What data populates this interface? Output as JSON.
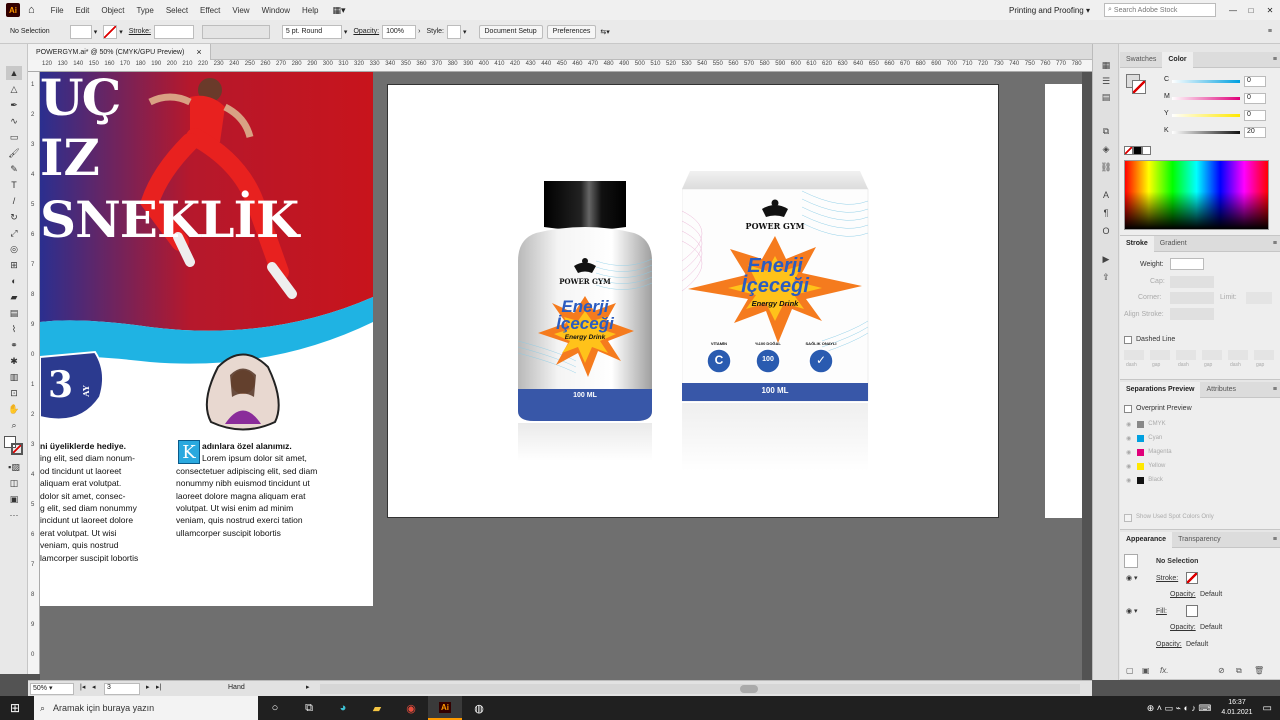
{
  "menubar": {
    "app_logo": "Ai",
    "items": [
      "File",
      "Edit",
      "Object",
      "Type",
      "Select",
      "Effect",
      "View",
      "Window",
      "Help"
    ],
    "workspace": "Printing and Proofing",
    "search_placeholder": "Search Adobe Stock"
  },
  "controlbar": {
    "selection": "No Selection",
    "stroke_label": "Stroke:",
    "brush": "5 pt. Round",
    "opacity_label": "Opacity:",
    "opacity_value": "100%",
    "style_label": "Style:",
    "document_setup": "Document Setup",
    "preferences": "Preferences"
  },
  "document": {
    "tab_title": "POWERGYM.ai* @ 50% (CMYK/GPU Preview)",
    "tab_close": "×"
  },
  "ruler": {
    "top": [
      "120",
      "130",
      "140",
      "150",
      "160",
      "170",
      "180",
      "190",
      "200",
      "210",
      "220",
      "230",
      "240",
      "250",
      "260",
      "270",
      "280",
      "290",
      "300",
      "310",
      "320",
      "330",
      "340",
      "350",
      "360",
      "370",
      "380",
      "390",
      "400",
      "410",
      "420",
      "430",
      "440",
      "450",
      "460",
      "470",
      "480",
      "490",
      "500",
      "510",
      "520",
      "530",
      "540",
      "550",
      "560",
      "570",
      "580",
      "590",
      "600",
      "610",
      "620",
      "630",
      "640",
      "650",
      "660",
      "670",
      "680",
      "690",
      "700",
      "710",
      "720",
      "730",
      "740",
      "750",
      "760",
      "770",
      "780"
    ],
    "left": [
      "1",
      "2",
      "3",
      "4",
      "5",
      "6",
      "7",
      "8",
      "9",
      "0",
      "1",
      "2",
      "3",
      "4",
      "5",
      "6",
      "7",
      "8",
      "9",
      "0"
    ]
  },
  "poster": {
    "headline_1": "UÇ",
    "headline_2": "IZ",
    "headline_3": "SNEKLİK",
    "badge_number": "3",
    "badge_suffix": "AY",
    "col1_lines": [
      "ni üyeliklerde hediye.",
      "ing elit, sed diam nonum-",
      "od tincidunt ut laoreet",
      "aliquam erat volutpat.",
      "dolor sit amet, consec-",
      "g elit, sed diam nonummy",
      "incidunt ut laoreet dolore",
      "erat volutpat. Ut wisi",
      "veniam, quis nostrud",
      "lamcorper suscipit lobortis"
    ],
    "dropcap": "K",
    "col2_first": "adınlara özel alanımız.",
    "col2_lines": [
      "Lorem ipsum dolor sit amet,",
      "consectetuer adipiscing elit, sed diam",
      "nonummy nibh euismod tincidunt ut",
      "laoreet dolore magna aliquam erat",
      "volutpat. Ut wisi enim ad minim",
      "veniam, quis nostrud exerci tation",
      "ullamcorper suscipit lobortis"
    ]
  },
  "bottle": {
    "brand": "POWER GYM",
    "title_1": "Enerji",
    "title_2": "İçeceği",
    "subtitle": "Energy Drink",
    "volume": "100 ML"
  },
  "box": {
    "brand": "POWER GYM",
    "title_1": "Enerji",
    "title_2": "İçeceği",
    "subtitle": "Energy Drink",
    "badge_1_label": "VİTAMİN",
    "badge_1_value": "C",
    "badge_2_label": "%100 DOĞAL",
    "badge_2_value": "100",
    "badge_3_label": "SAĞLIK ONAYLI",
    "badge_3_value": "✓",
    "volume": "100 ML"
  },
  "color_panel": {
    "tabs": [
      "Swatches",
      "Color"
    ],
    "channels": [
      {
        "label": "C",
        "value": "0"
      },
      {
        "label": "M",
        "value": "0"
      },
      {
        "label": "Y",
        "value": "0"
      },
      {
        "label": "K",
        "value": "20"
      }
    ]
  },
  "stroke_panel": {
    "tabs": [
      "Stroke",
      "Gradient"
    ],
    "weight_label": "Weight:",
    "cap_label": "Cap:",
    "corner_label": "Corner:",
    "limit_label": "Limit:",
    "align_label": "Align Stroke:",
    "dashed_label": "Dashed Line",
    "dash_labels": [
      "dash",
      "gap",
      "dash",
      "gap",
      "dash",
      "gap"
    ]
  },
  "separations_panel": {
    "tabs": [
      "Separations Preview",
      "Attributes"
    ],
    "overprint": "Overprint Preview",
    "inks": [
      {
        "name": "CMYK",
        "color": "#888888"
      },
      {
        "name": "Cyan",
        "color": "#00a0e0"
      },
      {
        "name": "Magenta",
        "color": "#e0007a"
      },
      {
        "name": "Yellow",
        "color": "#ffe800"
      },
      {
        "name": "Black",
        "color": "#111111"
      }
    ],
    "spot_only": "Show Used Spot Colors Only"
  },
  "appearance_panel": {
    "tabs": [
      "Appearance",
      "Transparency"
    ],
    "title": "No Selection",
    "stroke": "Stroke:",
    "fill": "Fill:",
    "opacity": "Opacity:",
    "default": "Default"
  },
  "status": {
    "zoom": "50%",
    "artboard": "3",
    "tool": "Hand"
  },
  "taskbar": {
    "search": "Aramak için buraya yazın",
    "time": "16:37",
    "date": "4.01.2021"
  }
}
